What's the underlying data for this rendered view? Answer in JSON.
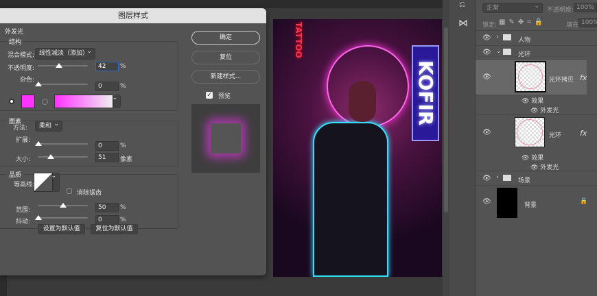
{
  "dialog": {
    "title": "图层样式",
    "section": "外发光",
    "structure": {
      "title": "结构",
      "blend_label": "混合模式:",
      "blend_value": "线性减淡（添加）",
      "opacity_label": "不透明度:",
      "opacity_value": "42",
      "noise_label": "杂色:",
      "noise_value": "0",
      "percent": "%",
      "color": "#ff33ff"
    },
    "elements": {
      "title": "图素",
      "method_label": "方法:",
      "method_value": "柔和",
      "spread_label": "扩展:",
      "spread_value": "0",
      "size_label": "大小:",
      "size_value": "51",
      "size_unit": "像素"
    },
    "quality": {
      "title": "品质",
      "contour_label": "等高线:",
      "antialias_label": "消除锯齿",
      "range_label": "范围:",
      "range_value": "50",
      "jitter_label": "抖动:",
      "jitter_value": "0"
    },
    "default_btn": "设置为默认值",
    "reset_default_btn": "复位为默认值",
    "ok": "确定",
    "reset": "复位",
    "new_style": "新建样式...",
    "preview": "预览"
  },
  "layers_panel": {
    "blend": "正常",
    "opacity_label": "不透明度:",
    "opacity": "100%",
    "lock_label": "锁定:",
    "fill_label": "填充:",
    "fill": "100%",
    "layers": [
      {
        "name": "人物"
      },
      {
        "name": "光环"
      },
      {
        "name": "光环拷贝",
        "effects": "效果",
        "effect": "外发光"
      },
      {
        "name": "光环",
        "effects": "效果",
        "effect": "外发光"
      },
      {
        "name": "场景"
      },
      {
        "name": "背景"
      }
    ],
    "fx": "fx"
  },
  "canvas": {
    "signs": [
      "TATTOO",
      "KOFIR"
    ]
  }
}
